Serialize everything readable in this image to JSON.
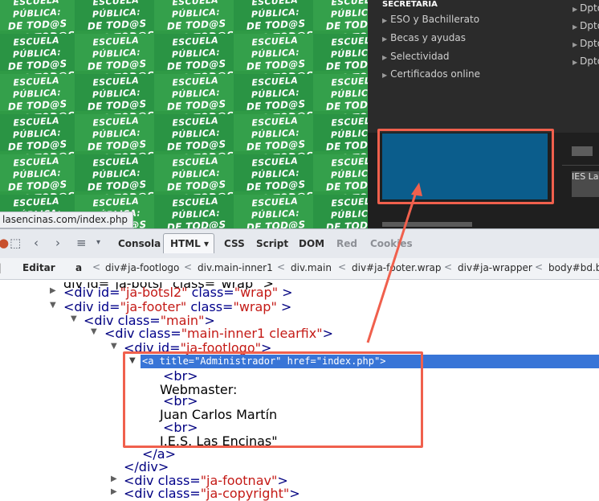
{
  "website": {
    "banner_lines": [
      "ESCUELA PÚBLICA:",
      "DE TOD@S",
      "PARA TOD@S"
    ],
    "status_url": "lasencinas.com/index.php",
    "secretaria_heading": "SECRETARIA",
    "menu_items": [
      "ESO y Bachillerato",
      "Becas y ayudas",
      "Selectividad",
      "Certificados online"
    ],
    "dpto_items": [
      "Dpto",
      "Dpto",
      "Dpto",
      "Dpto"
    ],
    "right_text": "IES La"
  },
  "firebug": {
    "tabs": [
      {
        "label": "Consola",
        "active": false
      },
      {
        "label": "HTML",
        "active": true
      },
      {
        "label": "CSS",
        "active": false
      },
      {
        "label": "Script",
        "active": false
      },
      {
        "label": "DOM",
        "active": false
      },
      {
        "label": "Red",
        "active": false,
        "dim": true
      },
      {
        "label": "Cookies",
        "active": false,
        "dim": true
      }
    ],
    "html_tab_dropdown": "▾",
    "edit_label": "Editar",
    "breadcrumbs": [
      "a",
      "div#ja-footlogo",
      "div.main-inner1",
      "div.main",
      "div#ja-footer.wrap",
      "div#ja-wrapper",
      "body#bd.bd"
    ]
  },
  "tree": {
    "partial_top": "div id=\"ja-botsl\" class=\"wrap\" >",
    "rows": [
      {
        "text_tag": "<div ",
        "attr1": "id=",
        "val1": "\"ja-botsl2\"",
        "attr2": " class=",
        "val2": "\"wrap\"",
        "end": " >"
      },
      {
        "text_tag": "<div ",
        "attr1": "id=",
        "val1": "\"ja-footer\"",
        "attr2": " class=",
        "val2": "\"wrap\"",
        "end": " >"
      },
      {
        "text_tag": "<div ",
        "attr1": "class=",
        "val1": "\"main\"",
        "attr2": "",
        "val2": "",
        "end": ">"
      },
      {
        "text_tag": "<div ",
        "attr1": "class=",
        "val1": "\"main-inner1 clearfix\"",
        "attr2": "",
        "val2": "",
        "end": ">"
      },
      {
        "text_tag": "<div ",
        "attr1": "id=",
        "val1": "\"ja-footlogo\"",
        "attr2": "",
        "val2": "",
        "end": ">"
      }
    ],
    "selected": "<a title=\"Administrador\" href=\"index.php\">",
    "children": [
      "<br>",
      "Webmaster:",
      "<br>",
      "Juan Carlos Martín",
      "<br>",
      "I.E.S. Las Encinas\""
    ],
    "close_a": "</a>",
    "close_div": "</div>",
    "after_rows": [
      {
        "text_tag": "<div ",
        "attr1": "class=",
        "val1": "\"ja-footnav\"",
        "end": ">"
      },
      {
        "text_tag": "<div ",
        "attr1": "class=",
        "val1": "\"ja-copyright\"",
        "end": ">"
      }
    ]
  },
  "colors": {
    "banner_green": "#2f9a45",
    "highlight_red": "#f0604d",
    "selection_blue": "#3875d7",
    "link_box_blue": "#0b5d8c"
  }
}
